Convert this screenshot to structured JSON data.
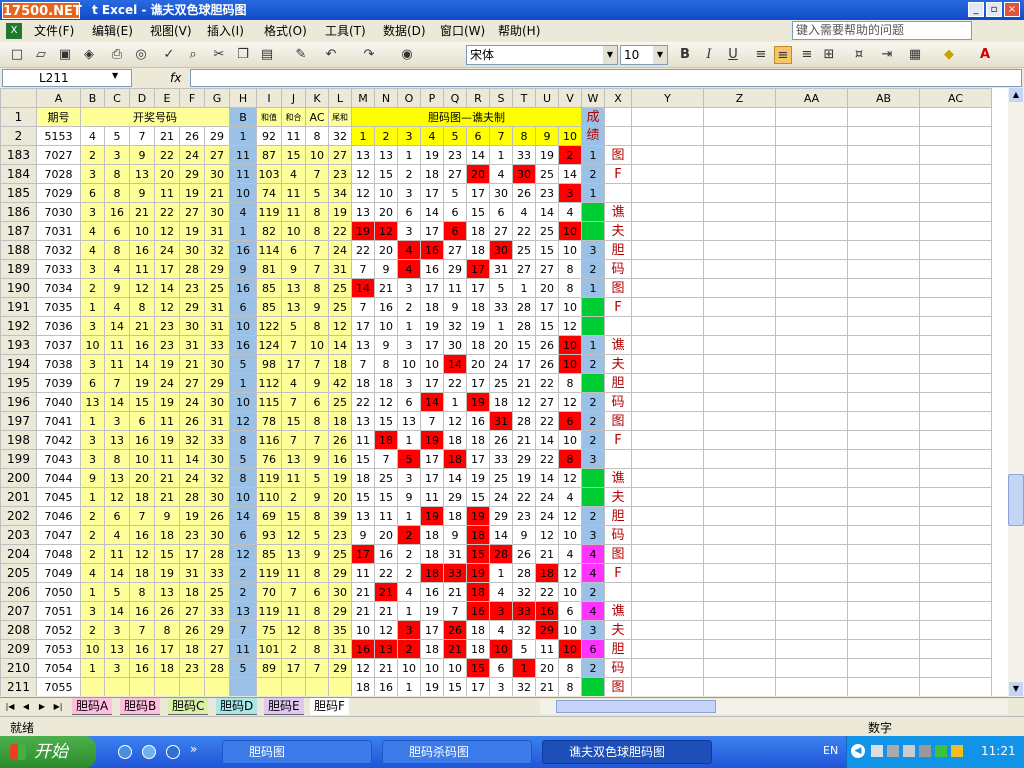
{
  "app": {
    "logo": "17500.NET",
    "title": "t Excel - 谯夫双色球胆码图"
  },
  "menu": [
    "文件(F)",
    "编辑(E)",
    "视图(V)",
    "插入(I)",
    "格式(O)",
    "工具(T)",
    "数据(D)",
    "窗口(W)",
    "帮助(H)"
  ],
  "help_placeholder": "键入需要帮助的问题",
  "font_name": "宋体",
  "font_size": "10",
  "name_box": "L211",
  "fx": "fx",
  "toolbar": {
    "bold": "B",
    "italic": "I",
    "underline": "U"
  },
  "col_letters": [
    "A",
    "B",
    "C",
    "D",
    "E",
    "F",
    "G",
    "H",
    "I",
    "J",
    "K",
    "L",
    "M",
    "N",
    "O",
    "P",
    "Q",
    "R",
    "S",
    "T",
    "U",
    "V",
    "W",
    "X",
    "Y",
    "Z",
    "AA",
    "AB",
    "AC"
  ],
  "header": {
    "r1": "1",
    "r2": "2",
    "qihao": "期号",
    "kaijiang": "开奖号码",
    "b": "B",
    "hezhi": "和值",
    "weihe": "和合",
    "ac": "AC",
    "weihe2": "尾和",
    "danma": "胆码图—谯夫制",
    "chengji": "成绩",
    "p2_a": "5153",
    "p2_balls": [
      "4",
      "5",
      "7",
      "21",
      "26",
      "29"
    ],
    "p2_b": "1",
    "p2_h": "92",
    "p2_j": "11",
    "p2_k": "8",
    "p2_l": "32",
    "nums": [
      "1",
      "2",
      "3",
      "4",
      "5",
      "6",
      "7",
      "8",
      "9",
      "10"
    ]
  },
  "rows": [
    {
      "r": "183",
      "a": "7027",
      "b": [
        "2",
        "3",
        "9",
        "22",
        "24",
        "27"
      ],
      "h": "11",
      "i": "87",
      "j": "15",
      "k": "10",
      "l": "27",
      "m": [
        "13",
        "13",
        "1",
        "19",
        "23",
        "14",
        "1",
        "33",
        "19",
        "2"
      ],
      "red": [
        9
      ],
      "w": "1",
      "wc": "b",
      "x": "图"
    },
    {
      "r": "184",
      "a": "7028",
      "b": [
        "3",
        "8",
        "13",
        "20",
        "29",
        "30"
      ],
      "h": "11",
      "i": "103",
      "j": "4",
      "k": "7",
      "l": "23",
      "m": [
        "12",
        "15",
        "2",
        "18",
        "27",
        "20",
        "4",
        "30",
        "25",
        "14"
      ],
      "red": [
        5,
        7
      ],
      "w": "2",
      "wc": "b",
      "x": "F"
    },
    {
      "r": "185",
      "a": "7029",
      "b": [
        "6",
        "8",
        "9",
        "11",
        "19",
        "21"
      ],
      "h": "10",
      "i": "74",
      "j": "11",
      "k": "5",
      "l": "34",
      "m": [
        "12",
        "10",
        "3",
        "17",
        "5",
        "17",
        "30",
        "26",
        "23",
        "3"
      ],
      "red": [
        9
      ],
      "w": "1",
      "wc": "b",
      "x": ""
    },
    {
      "r": "186",
      "a": "7030",
      "b": [
        "3",
        "16",
        "21",
        "22",
        "27",
        "30"
      ],
      "h": "4",
      "i": "119",
      "j": "11",
      "k": "8",
      "l": "19",
      "m": [
        "13",
        "20",
        "6",
        "14",
        "6",
        "15",
        "6",
        "4",
        "14",
        "4"
      ],
      "red": [],
      "w": "",
      "wc": "g",
      "x": "谯"
    },
    {
      "r": "187",
      "a": "7031",
      "b": [
        "4",
        "6",
        "10",
        "12",
        "19",
        "31"
      ],
      "h": "1",
      "i": "82",
      "j": "10",
      "k": "8",
      "l": "22",
      "m": [
        "19",
        "12",
        "3",
        "17",
        "6",
        "18",
        "27",
        "22",
        "25",
        "10"
      ],
      "red": [
        0,
        1,
        4,
        9
      ],
      "w": "",
      "wc": "g",
      "x": "夫"
    },
    {
      "r": "188",
      "a": "7032",
      "b": [
        "4",
        "8",
        "16",
        "24",
        "30",
        "32"
      ],
      "h": "16",
      "i": "114",
      "j": "6",
      "k": "7",
      "l": "24",
      "m": [
        "22",
        "20",
        "4",
        "16",
        "27",
        "18",
        "30",
        "25",
        "15",
        "10"
      ],
      "red": [
        2,
        3,
        6
      ],
      "w": "3",
      "wc": "b",
      "x": "胆"
    },
    {
      "r": "189",
      "a": "7033",
      "b": [
        "3",
        "4",
        "11",
        "17",
        "28",
        "29"
      ],
      "h": "9",
      "i": "81",
      "j": "9",
      "k": "7",
      "l": "31",
      "m": [
        "7",
        "9",
        "4",
        "16",
        "29",
        "17",
        "31",
        "27",
        "27",
        "8"
      ],
      "red": [
        2,
        5
      ],
      "w": "2",
      "wc": "b",
      "x": "码"
    },
    {
      "r": "190",
      "a": "7034",
      "b": [
        "2",
        "9",
        "12",
        "14",
        "23",
        "25"
      ],
      "h": "16",
      "i": "85",
      "j": "13",
      "k": "8",
      "l": "25",
      "m": [
        "14",
        "21",
        "3",
        "17",
        "11",
        "17",
        "5",
        "1",
        "20",
        "8"
      ],
      "red": [
        0
      ],
      "w": "1",
      "wc": "b",
      "x": "图"
    },
    {
      "r": "191",
      "a": "7035",
      "b": [
        "1",
        "4",
        "8",
        "12",
        "29",
        "31"
      ],
      "h": "6",
      "i": "85",
      "j": "13",
      "k": "9",
      "l": "25",
      "m": [
        "7",
        "16",
        "2",
        "18",
        "9",
        "18",
        "33",
        "28",
        "17",
        "10"
      ],
      "red": [],
      "w": "",
      "wc": "g",
      "x": "F"
    },
    {
      "r": "192",
      "a": "7036",
      "b": [
        "3",
        "14",
        "21",
        "23",
        "30",
        "31"
      ],
      "h": "10",
      "i": "122",
      "j": "5",
      "k": "8",
      "l": "12",
      "m": [
        "17",
        "10",
        "1",
        "19",
        "32",
        "19",
        "1",
        "28",
        "15",
        "12"
      ],
      "red": [],
      "w": "",
      "wc": "g",
      "x": ""
    },
    {
      "r": "193",
      "a": "7037",
      "b": [
        "10",
        "11",
        "16",
        "23",
        "31",
        "33"
      ],
      "h": "16",
      "i": "124",
      "j": "7",
      "k": "10",
      "l": "14",
      "m": [
        "13",
        "9",
        "3",
        "17",
        "30",
        "18",
        "20",
        "15",
        "26",
        "10"
      ],
      "red": [
        9
      ],
      "w": "1",
      "wc": "b",
      "x": "谯"
    },
    {
      "r": "194",
      "a": "7038",
      "b": [
        "3",
        "11",
        "14",
        "19",
        "21",
        "30"
      ],
      "h": "5",
      "i": "98",
      "j": "17",
      "k": "7",
      "l": "18",
      "m": [
        "7",
        "8",
        "10",
        "10",
        "14",
        "20",
        "24",
        "17",
        "26",
        "10"
      ],
      "red": [
        4,
        9
      ],
      "w": "2",
      "wc": "b",
      "x": "夫"
    },
    {
      "r": "195",
      "a": "7039",
      "b": [
        "6",
        "7",
        "19",
        "24",
        "27",
        "29"
      ],
      "h": "1",
      "i": "112",
      "j": "4",
      "k": "9",
      "l": "42",
      "m": [
        "18",
        "18",
        "3",
        "17",
        "22",
        "17",
        "25",
        "21",
        "22",
        "8"
      ],
      "red": [],
      "w": "",
      "wc": "g",
      "x": "胆"
    },
    {
      "r": "196",
      "a": "7040",
      "b": [
        "13",
        "14",
        "15",
        "19",
        "24",
        "30"
      ],
      "h": "10",
      "i": "115",
      "j": "7",
      "k": "6",
      "l": "25",
      "m": [
        "22",
        "12",
        "6",
        "14",
        "1",
        "19",
        "18",
        "12",
        "27",
        "12"
      ],
      "red": [
        3,
        5
      ],
      "w": "2",
      "wc": "b",
      "x": "码"
    },
    {
      "r": "197",
      "a": "7041",
      "b": [
        "1",
        "3",
        "6",
        "11",
        "26",
        "31"
      ],
      "h": "12",
      "i": "78",
      "j": "15",
      "k": "8",
      "l": "18",
      "m": [
        "13",
        "15",
        "13",
        "7",
        "12",
        "16",
        "31",
        "28",
        "22",
        "6"
      ],
      "red": [
        6,
        9
      ],
      "w": "2",
      "wc": "b",
      "x": "图"
    },
    {
      "r": "198",
      "a": "7042",
      "b": [
        "3",
        "13",
        "16",
        "19",
        "32",
        "33"
      ],
      "h": "8",
      "i": "116",
      "j": "7",
      "k": "7",
      "l": "26",
      "m": [
        "11",
        "18",
        "1",
        "19",
        "18",
        "18",
        "26",
        "21",
        "14",
        "10"
      ],
      "red": [
        1,
        3
      ],
      "w": "2",
      "wc": "b",
      "x": "F"
    },
    {
      "r": "199",
      "a": "7043",
      "b": [
        "3",
        "8",
        "10",
        "11",
        "14",
        "30"
      ],
      "h": "5",
      "i": "76",
      "j": "13",
      "k": "9",
      "l": "16",
      "m": [
        "15",
        "7",
        "5",
        "17",
        "18",
        "17",
        "33",
        "29",
        "22",
        "8"
      ],
      "red": [
        2,
        4,
        9
      ],
      "w": "3",
      "wc": "b",
      "x": ""
    },
    {
      "r": "200",
      "a": "7044",
      "b": [
        "9",
        "13",
        "20",
        "21",
        "24",
        "32"
      ],
      "h": "8",
      "i": "119",
      "j": "11",
      "k": "5",
      "l": "19",
      "m": [
        "18",
        "25",
        "3",
        "17",
        "14",
        "19",
        "25",
        "19",
        "14",
        "12"
      ],
      "red": [],
      "w": "",
      "wc": "g",
      "x": "谯"
    },
    {
      "r": "201",
      "a": "7045",
      "b": [
        "1",
        "12",
        "18",
        "21",
        "28",
        "30"
      ],
      "h": "10",
      "i": "110",
      "j": "2",
      "k": "9",
      "l": "20",
      "m": [
        "15",
        "15",
        "9",
        "11",
        "29",
        "15",
        "24",
        "22",
        "24",
        "4"
      ],
      "red": [],
      "w": "",
      "wc": "g",
      "x": "夫"
    },
    {
      "r": "202",
      "a": "7046",
      "b": [
        "2",
        "6",
        "7",
        "9",
        "19",
        "26"
      ],
      "h": "14",
      "i": "69",
      "j": "15",
      "k": "8",
      "l": "39",
      "m": [
        "13",
        "11",
        "1",
        "19",
        "18",
        "19",
        "29",
        "23",
        "24",
        "12"
      ],
      "red": [
        3,
        5
      ],
      "w": "2",
      "wc": "b",
      "x": "胆"
    },
    {
      "r": "203",
      "a": "7047",
      "b": [
        "2",
        "4",
        "16",
        "18",
        "23",
        "30"
      ],
      "h": "6",
      "i": "93",
      "j": "12",
      "k": "5",
      "l": "23",
      "m": [
        "9",
        "20",
        "2",
        "18",
        "9",
        "18",
        "14",
        "9",
        "12",
        "10"
      ],
      "red": [
        2,
        5
      ],
      "w": "3",
      "wc": "b",
      "x": "码"
    },
    {
      "r": "204",
      "a": "7048",
      "b": [
        "2",
        "11",
        "12",
        "15",
        "17",
        "28"
      ],
      "h": "12",
      "i": "85",
      "j": "13",
      "k": "9",
      "l": "25",
      "m": [
        "17",
        "16",
        "2",
        "18",
        "31",
        "15",
        "28",
        "26",
        "21",
        "4"
      ],
      "red": [
        0,
        5,
        6
      ],
      "w": "4",
      "wc": "p",
      "x": "图"
    },
    {
      "r": "205",
      "a": "7049",
      "b": [
        "4",
        "14",
        "18",
        "19",
        "31",
        "33"
      ],
      "h": "2",
      "i": "119",
      "j": "11",
      "k": "8",
      "l": "29",
      "m": [
        "11",
        "22",
        "2",
        "18",
        "33",
        "19",
        "1",
        "28",
        "18",
        "12"
      ],
      "red": [
        3,
        4,
        5,
        8
      ],
      "w": "4",
      "wc": "p",
      "x": "F"
    },
    {
      "r": "206",
      "a": "7050",
      "b": [
        "1",
        "5",
        "8",
        "13",
        "18",
        "25"
      ],
      "h": "2",
      "i": "70",
      "j": "7",
      "k": "6",
      "l": "30",
      "m": [
        "21",
        "21",
        "4",
        "16",
        "21",
        "18",
        "4",
        "32",
        "22",
        "10"
      ],
      "red": [
        1,
        5
      ],
      "w": "2",
      "wc": "b",
      "x": ""
    },
    {
      "r": "207",
      "a": "7051",
      "b": [
        "3",
        "14",
        "16",
        "26",
        "27",
        "33"
      ],
      "h": "13",
      "i": "119",
      "j": "11",
      "k": "8",
      "l": "29",
      "m": [
        "21",
        "21",
        "1",
        "19",
        "7",
        "16",
        "3",
        "33",
        "16",
        "6"
      ],
      "red": [
        5,
        6,
        7,
        8
      ],
      "w": "4",
      "wc": "p",
      "x": "谯"
    },
    {
      "r": "208",
      "a": "7052",
      "b": [
        "2",
        "3",
        "7",
        "8",
        "26",
        "29"
      ],
      "h": "7",
      "i": "75",
      "j": "12",
      "k": "8",
      "l": "35",
      "m": [
        "10",
        "12",
        "3",
        "17",
        "26",
        "18",
        "4",
        "32",
        "29",
        "10"
      ],
      "red": [
        2,
        4,
        8
      ],
      "w": "3",
      "wc": "b",
      "x": "夫"
    },
    {
      "r": "209",
      "a": "7053",
      "b": [
        "10",
        "13",
        "16",
        "17",
        "18",
        "27"
      ],
      "h": "11",
      "i": "101",
      "j": "2",
      "k": "8",
      "l": "31",
      "m": [
        "16",
        "13",
        "2",
        "18",
        "21",
        "18",
        "10",
        "5",
        "11",
        "10"
      ],
      "red": [
        0,
        1,
        2,
        4,
        6,
        9
      ],
      "w": "6",
      "wc": "p",
      "x": "胆"
    },
    {
      "r": "210",
      "a": "7054",
      "b": [
        "1",
        "3",
        "16",
        "18",
        "23",
        "28"
      ],
      "h": "5",
      "i": "89",
      "j": "17",
      "k": "7",
      "l": "29",
      "m": [
        "12",
        "21",
        "10",
        "10",
        "10",
        "15",
        "6",
        "1",
        "20",
        "8"
      ],
      "red": [
        5,
        7
      ],
      "w": "2",
      "wc": "b",
      "x": "码"
    },
    {
      "r": "211",
      "a": "7055",
      "b": [
        "",
        "",
        "",
        "",
        "",
        ""
      ],
      "h": "",
      "i": "",
      "j": "",
      "k": "",
      "l": "",
      "m": [
        "18",
        "16",
        "1",
        "19",
        "15",
        "17",
        "3",
        "32",
        "21",
        "8"
      ],
      "red": [],
      "w": "",
      "wc": "g",
      "x": "图"
    }
  ],
  "sheets": [
    "胆码A",
    "胆码B",
    "胆码C",
    "胆码D",
    "胆码E",
    "胆码F"
  ],
  "status": {
    "ready": "就绪",
    "mode": "数字"
  },
  "taskbar": {
    "start": "开始",
    "tasks": [
      "胆码图",
      "胆码杀码图",
      "谯夫双色球胆码图"
    ],
    "lang": "EN",
    "clock": "11:21"
  },
  "colors": {
    "yellow": "#FFFF99",
    "blue": "#9BC2E6",
    "red": "#FF0000",
    "green": "#00CC33",
    "purple": "#FF33FF",
    "brightyellow": "#FFFF00"
  }
}
